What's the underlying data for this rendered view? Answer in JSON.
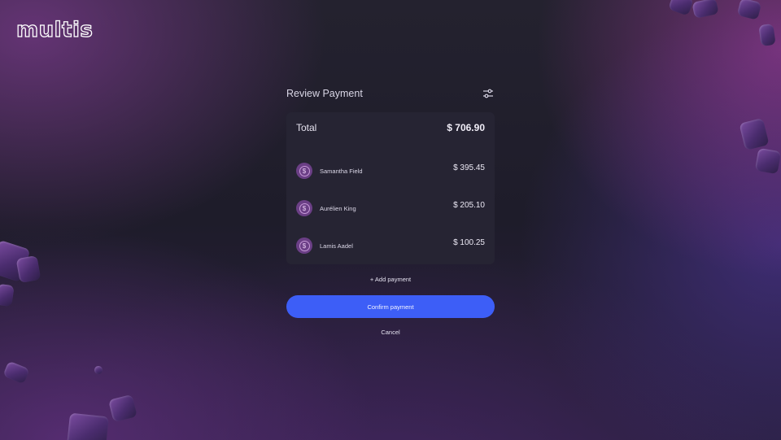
{
  "brand": {
    "logo_text": "multis"
  },
  "review": {
    "title": "Review Payment",
    "filter_icon": "sliders-icon",
    "total": {
      "label": "Total",
      "amount": "$ 706.90"
    },
    "payments": [
      {
        "name": "Samantha Field",
        "amount": "$ 395.45",
        "icon": "usdc-coin-icon"
      },
      {
        "name": "Aurélien King",
        "amount": "$ 205.10",
        "icon": "usdc-coin-icon"
      },
      {
        "name": "Lamis Aadel",
        "amount": "$ 100.25",
        "icon": "usdc-coin-icon"
      }
    ]
  },
  "actions": {
    "add_payment": "+ Add payment",
    "confirm": "Confirm payment",
    "cancel": "Cancel"
  },
  "colors": {
    "background": "#1f1d2c",
    "card": "#262433",
    "accent_button": "#3d5ef7",
    "coin": "#6b3f86"
  }
}
